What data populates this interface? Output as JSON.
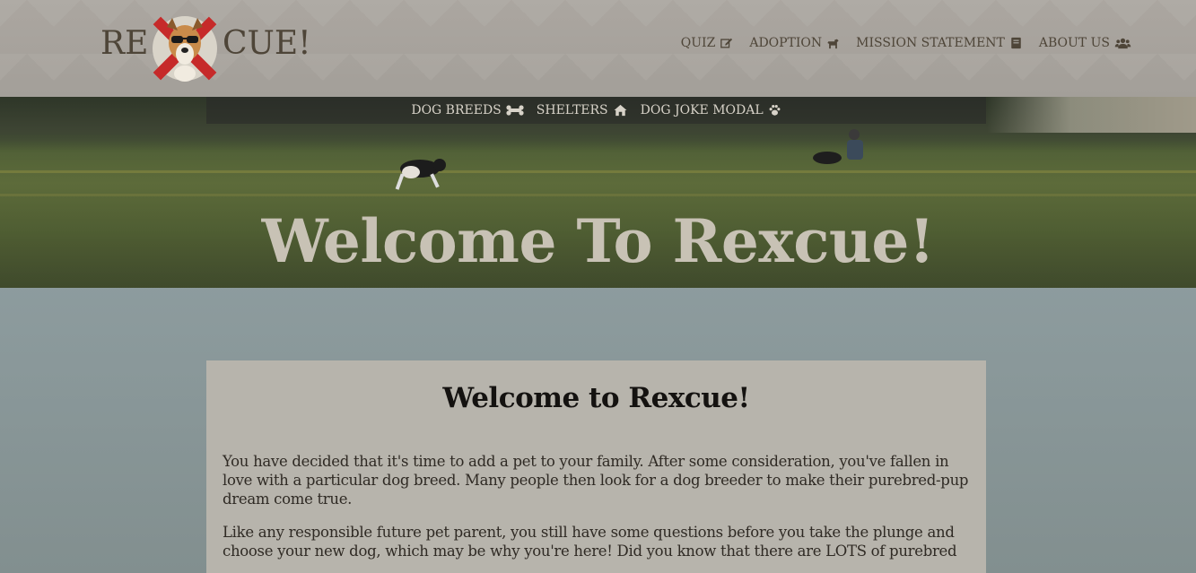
{
  "logo": {
    "left_text": "RE",
    "right_text": "CUE!",
    "badge_icon": "dog-with-sunglasses-icon"
  },
  "top_nav": [
    {
      "label": "QUIZ",
      "icon": "edit-icon"
    },
    {
      "label": "ADOPTION",
      "icon": "dog-icon"
    },
    {
      "label": "MISSION STATEMENT",
      "icon": "book-icon"
    },
    {
      "label": "ABOUT US",
      "icon": "users-icon"
    }
  ],
  "sub_nav": [
    {
      "label": "DOG BREEDS",
      "icon": "bone-icon"
    },
    {
      "label": "SHELTERS",
      "icon": "home-icon"
    },
    {
      "label": "DOG JOKE MODAL",
      "icon": "paw-icon"
    }
  ],
  "hero": {
    "title": "Welcome To Rexcue!"
  },
  "card": {
    "title": "Welcome to Rexcue!",
    "paragraph1": "You have decided that it's time to add a pet to your family. After some consideration, you've fallen in love with a particular dog breed. Many people then look for a dog breeder to make their purebred-pup dream come true.",
    "paragraph2": "Like any responsible future pet parent, you still have some questions before you take the plunge and choose your new dog, which may be why you're here! Did you know that there are LOTS of purebred"
  },
  "colors": {
    "nav_text": "#4e4538",
    "logo_red": "#c62a2a",
    "subnav_text": "#d7d2c8",
    "card_bg": "#b7b4ac"
  }
}
